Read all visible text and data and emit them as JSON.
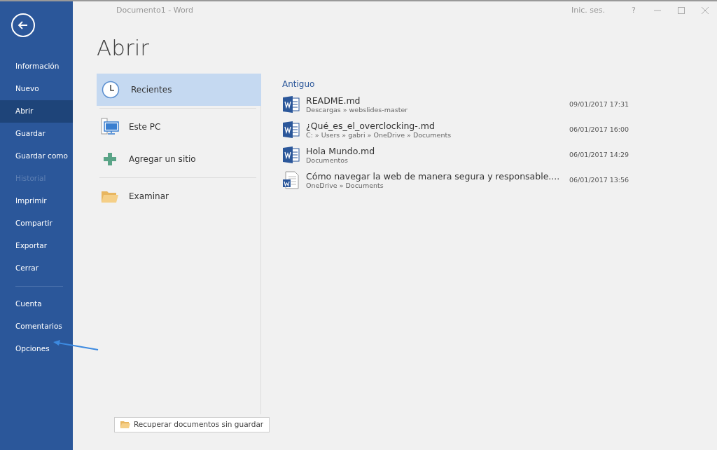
{
  "window": {
    "title": "Documento1  -  Word",
    "sign_in": "Inic. ses.",
    "help": "?"
  },
  "sidebar": {
    "items": [
      {
        "label": "Información",
        "selected": false,
        "disabled": false
      },
      {
        "label": "Nuevo",
        "selected": false,
        "disabled": false
      },
      {
        "label": "Abrir",
        "selected": true,
        "disabled": false
      },
      {
        "label": "Guardar",
        "selected": false,
        "disabled": false
      },
      {
        "label": "Guardar como",
        "selected": false,
        "disabled": false
      },
      {
        "label": "Historial",
        "selected": false,
        "disabled": true
      },
      {
        "label": "Imprimir",
        "selected": false,
        "disabled": false
      },
      {
        "label": "Compartir",
        "selected": false,
        "disabled": false
      },
      {
        "label": "Exportar",
        "selected": false,
        "disabled": false
      },
      {
        "label": "Cerrar",
        "selected": false,
        "disabled": false
      }
    ],
    "footer_items": [
      {
        "label": "Cuenta",
        "selected": false,
        "disabled": false
      },
      {
        "label": "Comentarios",
        "selected": false,
        "disabled": false
      },
      {
        "label": "Opciones",
        "selected": false,
        "disabled": false
      }
    ]
  },
  "page_title": "Abrir",
  "locations": [
    {
      "label": "Recientes",
      "kind": "clock",
      "selected": true
    },
    {
      "label": "Este PC",
      "kind": "pc",
      "selected": false
    },
    {
      "label": "Agregar un sitio",
      "kind": "plus",
      "selected": false
    },
    {
      "label": "Examinar",
      "kind": "folder",
      "selected": false
    }
  ],
  "recent": {
    "group": "Antiguo",
    "files": [
      {
        "name": "README.md",
        "path": "Descargas » webslides-master",
        "date": "09/01/2017 17:31",
        "kind": "word"
      },
      {
        "name": "¿Qué_es_el_overclocking-.md",
        "path": "C: » Users » gabri » OneDrive » Documents",
        "date": "06/01/2017 16:00",
        "kind": "word"
      },
      {
        "name": "Hola Mundo.md",
        "path": "Documentos",
        "date": "06/01/2017 14:29",
        "kind": "word"
      },
      {
        "name": "Cómo navegar la web de manera segura y responsable....",
        "path": "OneDrive » Documents",
        "date": "06/01/2017 13:56",
        "kind": "document"
      }
    ]
  },
  "recover_button": "Recuperar documentos sin guardar"
}
